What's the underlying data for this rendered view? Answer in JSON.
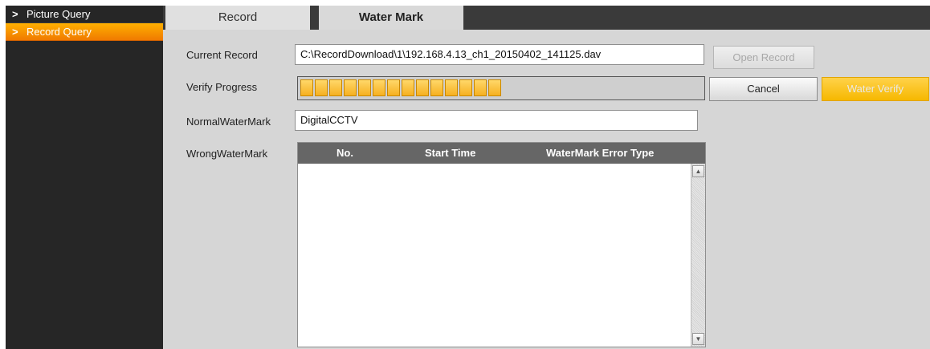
{
  "sidebar": {
    "items": [
      {
        "label": "Picture Query"
      },
      {
        "label": "Record Query"
      }
    ]
  },
  "tabs": {
    "record": "Record",
    "watermark": "Water Mark"
  },
  "form": {
    "current_record_label": "Current Record",
    "current_record_value": "C:\\RecordDownload\\1\\192.168.4.13_ch1_20150402_141125.dav",
    "verify_progress_label": "Verify Progress",
    "normal_watermark_label": "NormalWaterMark",
    "normal_watermark_value": "DigitalCCTV",
    "wrong_watermark_label": "WrongWaterMark"
  },
  "progress": {
    "filled_segments": 14,
    "fraction": 0.5
  },
  "buttons": {
    "open_record": "Open Record",
    "cancel": "Cancel",
    "water_verify": "Water Verify"
  },
  "table": {
    "columns": [
      "No.",
      "Start Time",
      "WaterMark Error Type"
    ],
    "rows": []
  },
  "colors": {
    "accent": "#f6b800",
    "active_sidebar": "#f07a00",
    "header": "#666666"
  }
}
